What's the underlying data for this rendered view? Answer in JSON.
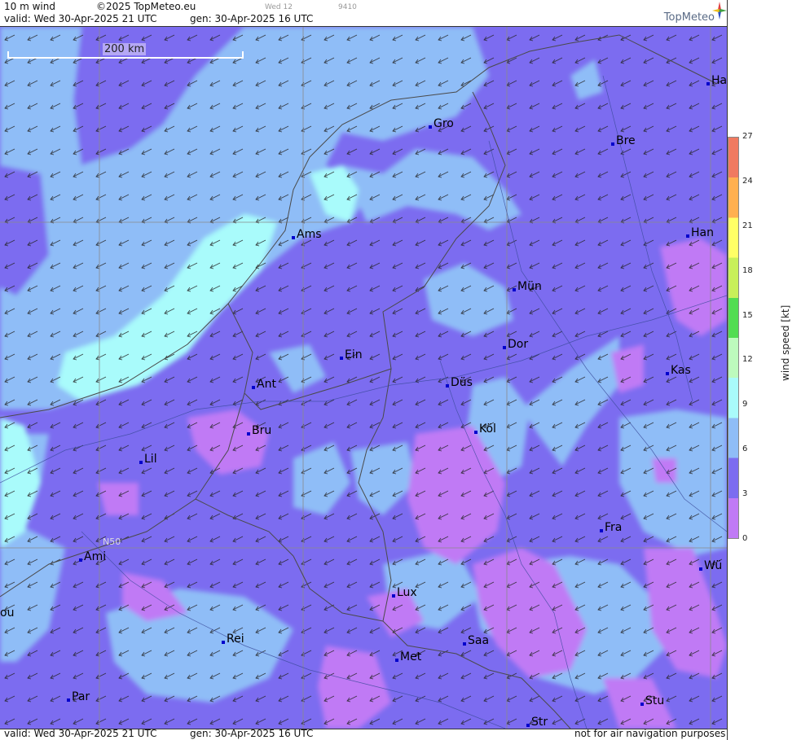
{
  "header": {
    "product": "10 m wind",
    "copyright": "©2025 TopMeteo.eu",
    "valid": "valid:  Wed  30-Apr-2025  21 UTC",
    "gen": "gen: 30-Apr-2025 16 UTC",
    "run_small": "Wed 12",
    "code_small": "9410",
    "logo": "TopMeteo"
  },
  "footer": {
    "valid": "valid:  Wed  30-Apr-2025  21 UTC",
    "gen": "gen: 30-Apr-2025 16 UTC",
    "disclaimer": "not for air navigation purposes"
  },
  "map": {
    "scale_label": "200 km",
    "lat_label": "N50",
    "cities": [
      {
        "name": "Ha"
      },
      {
        "name": "Gro"
      },
      {
        "name": "Bre"
      },
      {
        "name": "Ams"
      },
      {
        "name": "Han"
      },
      {
        "name": "Mün"
      },
      {
        "name": "Dor"
      },
      {
        "name": "Ein"
      },
      {
        "name": "Kas"
      },
      {
        "name": "Ant"
      },
      {
        "name": "Düs"
      },
      {
        "name": "Bru"
      },
      {
        "name": "Köl"
      },
      {
        "name": "Lil"
      },
      {
        "name": "Fra"
      },
      {
        "name": "Ami"
      },
      {
        "name": "Wü"
      },
      {
        "name": "ou"
      },
      {
        "name": "Lux"
      },
      {
        "name": "Rei"
      },
      {
        "name": "Saa"
      },
      {
        "name": "Met"
      },
      {
        "name": "Par"
      },
      {
        "name": "Stu"
      },
      {
        "name": "Str"
      }
    ]
  },
  "colorbar": {
    "label": "wind  speed  [kt]",
    "ticks": [
      "27",
      "24",
      "21",
      "18",
      "15",
      "12",
      "9",
      "6",
      "3",
      "0"
    ],
    "colors": [
      "#c07af5",
      "#7c6cf0",
      "#8fbdf7",
      "#a9fbfb",
      "#bdfbbd",
      "#52dd52",
      "#c8f05a",
      "#ffff66",
      "#ffb050",
      "#f07a60"
    ]
  }
}
